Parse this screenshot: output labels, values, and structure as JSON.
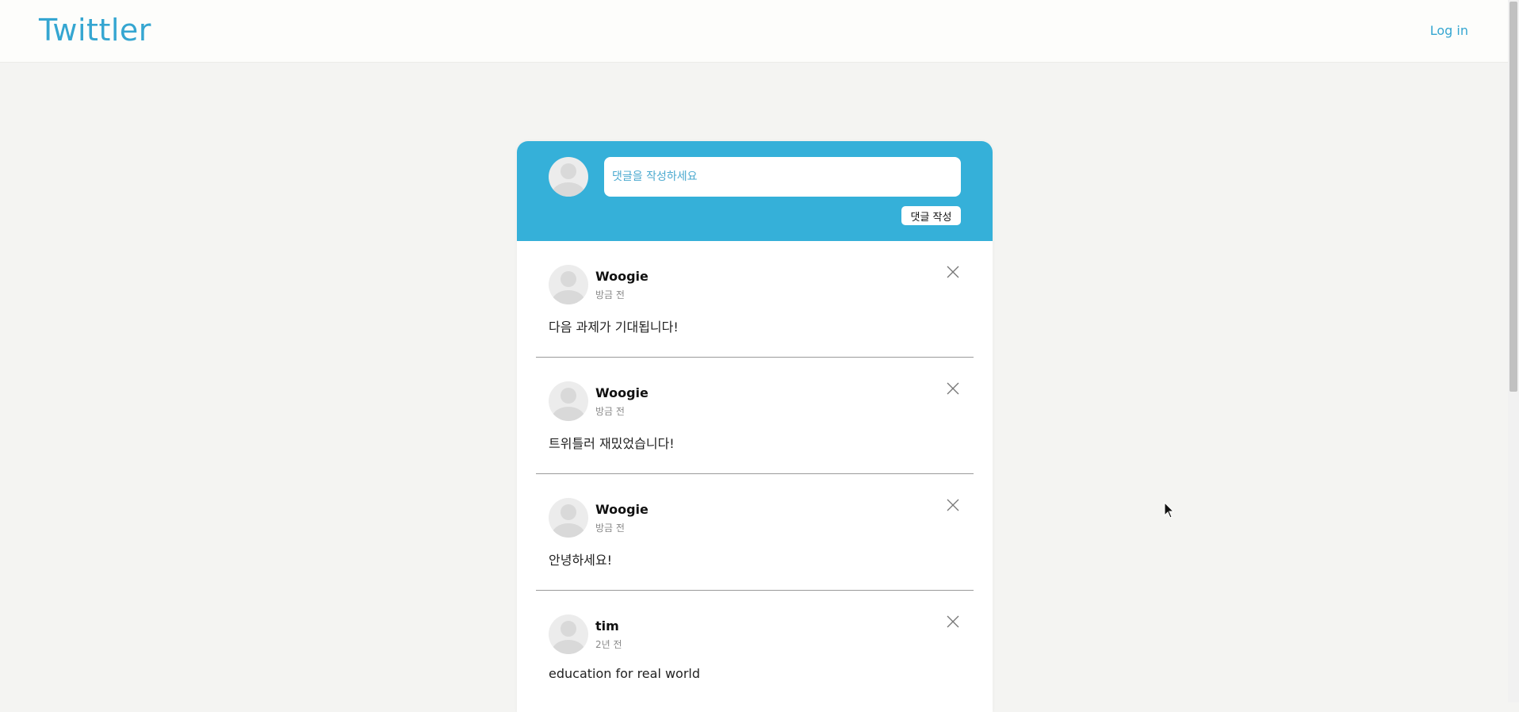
{
  "header": {
    "logo": "Twittler",
    "login_label": "Log in"
  },
  "compose": {
    "placeholder": "댓글을 작성하세요",
    "submit_label": "댓글 작성"
  },
  "comments": [
    {
      "username": "Woogie",
      "time": "방금 전",
      "text": "다음 과제가 기대됩니다!"
    },
    {
      "username": "Woogie",
      "time": "방금 전",
      "text": "트위틀러 재밌었습니다!"
    },
    {
      "username": "Woogie",
      "time": "방금 전",
      "text": "안녕하세요!"
    },
    {
      "username": "tim",
      "time": "2년 전",
      "text": "education for real world"
    }
  ],
  "colors": {
    "brand": "#35a6d1",
    "compose_bg": "#35b0d9",
    "page_bg": "#f4f4f2"
  },
  "icons": {
    "delete": "close-icon",
    "avatar": "user-avatar-icon"
  }
}
